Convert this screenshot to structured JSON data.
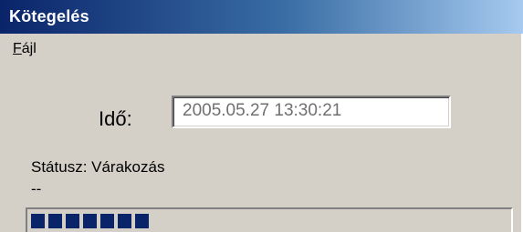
{
  "window": {
    "title": "Kötegelés"
  },
  "menu": {
    "items": [
      {
        "label": "Fájl",
        "mnemonic": "F",
        "rest": "ájl"
      }
    ]
  },
  "form": {
    "time_label": "Idő:",
    "time_value": "2005.05.27 13:30:21"
  },
  "status": {
    "text": "Státusz: Várakozás",
    "detail": "--"
  },
  "progress": {
    "filled_blocks": 7,
    "color": "#0a246a"
  },
  "colors": {
    "titlebar_start": "#0a246a",
    "titlebar_end": "#a6caf0",
    "window_bg": "#d4d0c8"
  }
}
